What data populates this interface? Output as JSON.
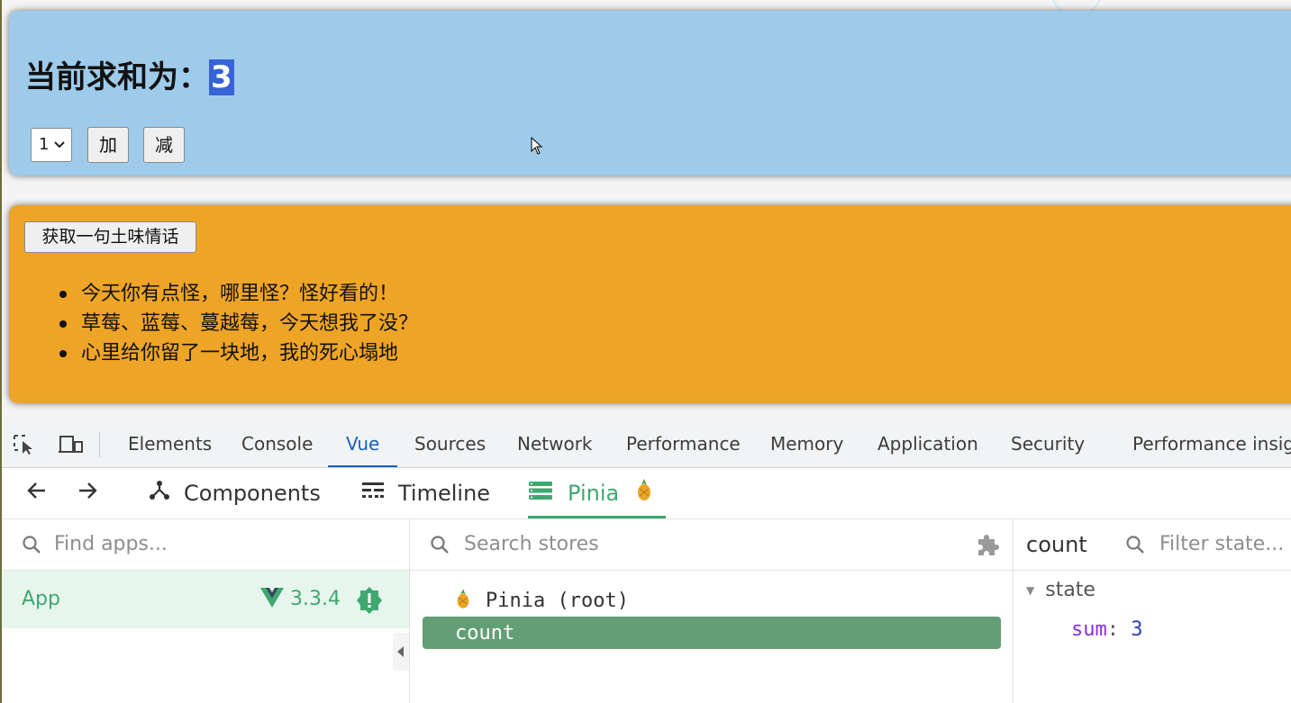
{
  "count_panel": {
    "title_prefix": "当前求和为：",
    "sum": "3",
    "select_value": "1",
    "add_label": "加",
    "sub_label": "减"
  },
  "talk_panel": {
    "button_label": "获取一句土味情话",
    "items": [
      "今天你有点怪，哪里怪？怪好看的！",
      "草莓、蓝莓、蔓越莓，今天想我了没？",
      "心里给你留了一块地，我的死心塌地"
    ]
  },
  "devtools": {
    "tabs": [
      "Elements",
      "Console",
      "Vue",
      "Sources",
      "Network",
      "Performance",
      "Memory",
      "Application",
      "Security",
      "Performance insigh"
    ],
    "active_tab": "Vue",
    "vue_tabs": [
      "Components",
      "Timeline",
      "Pinia"
    ],
    "active_vue_tab": "Pinia",
    "apps_search_placeholder": "Find apps...",
    "app_name": "App",
    "vue_version": "3.3.4",
    "stores_search_placeholder": "Search stores",
    "root_label": "Pinia (root)",
    "selected_store": "count",
    "inspector_title": "count",
    "state_filter_placeholder": "Filter state...",
    "state_label": "state",
    "state_key": "sum",
    "state_value": "3"
  },
  "colors": {
    "count_panel_bg": "#9ecbea",
    "talk_panel_bg": "#eea426",
    "vue_green": "#3fa871",
    "selected_store_bg": "#639f75",
    "devtools_active": "#1a5fbf"
  }
}
